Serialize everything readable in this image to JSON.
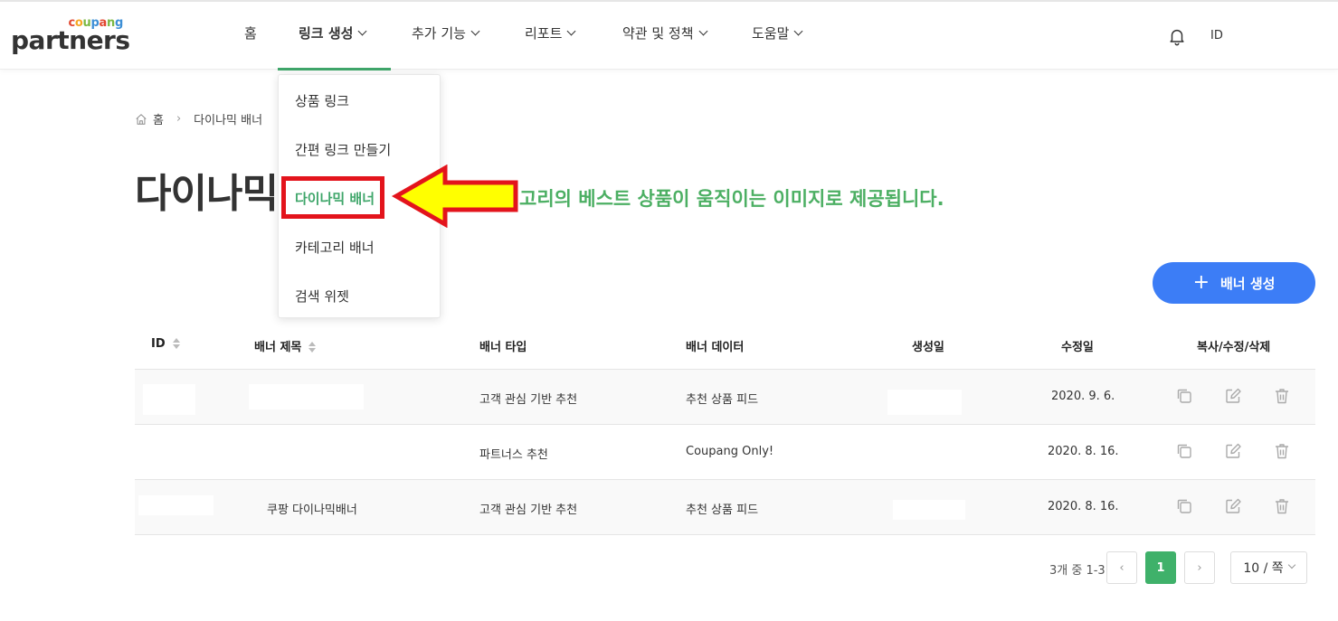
{
  "logo": {
    "small_text": "coupang",
    "main_text": "partners"
  },
  "nav": {
    "items": [
      {
        "label": "홈",
        "has_dropdown": false
      },
      {
        "label": "링크 생성",
        "has_dropdown": true,
        "active": true
      },
      {
        "label": "추가 기능",
        "has_dropdown": true
      },
      {
        "label": "리포트",
        "has_dropdown": true
      },
      {
        "label": "약관 및 정책",
        "has_dropdown": true
      },
      {
        "label": "도움말",
        "has_dropdown": true
      }
    ],
    "user_id": "ID"
  },
  "dropdown": {
    "items": [
      {
        "label": "상품 링크"
      },
      {
        "label": "간편 링크 만들기"
      },
      {
        "label": "다이나믹 배너",
        "active": true
      },
      {
        "label": "카테고리 배너"
      },
      {
        "label": "검색 위젯"
      }
    ]
  },
  "breadcrumb": {
    "home": "홈",
    "current": "다이나믹 배너"
  },
  "page": {
    "title": "다이나믹 배너",
    "description": "고리의 베스트 상품이 움직이는 이미지로 제공됩니다."
  },
  "create_button": {
    "label": "배너 생성",
    "icon": "plus-icon"
  },
  "table": {
    "headers": {
      "id": "ID",
      "title": "배너 제목",
      "type": "배너 타입",
      "data": "배너 데이터",
      "created": "생성일",
      "modified": "수정일",
      "actions": "복사/수정/삭제"
    },
    "rows": [
      {
        "id": "",
        "title": "",
        "type": "고객 관심 기반 추천",
        "data": "추천 상품 피드",
        "created": "",
        "modified": "2020. 9. 6."
      },
      {
        "id": "",
        "title": "",
        "type": "파트너스 추천",
        "data": "Coupang Only!",
        "created": "",
        "modified": "2020. 8. 16."
      },
      {
        "id": "",
        "title": "쿠팡 다이나믹배너",
        "type": "고객 관심 기반 추천",
        "data": "추천 상품 피드",
        "created": "",
        "modified": "2020. 8. 16."
      }
    ]
  },
  "pagination": {
    "info": "3개 중 1-3",
    "current_page": "1",
    "page_size": "10 / 쪽"
  },
  "colors": {
    "brand_green": "#3fa66a",
    "accent_blue": "#3c7df6",
    "highlight_red": "#e3141c",
    "arrow_yellow": "#ffff00",
    "logo_c": "#e2472f",
    "logo_o": "#f5a623",
    "logo_u": "#7bb843",
    "logo_p": "#3d8fd6"
  }
}
